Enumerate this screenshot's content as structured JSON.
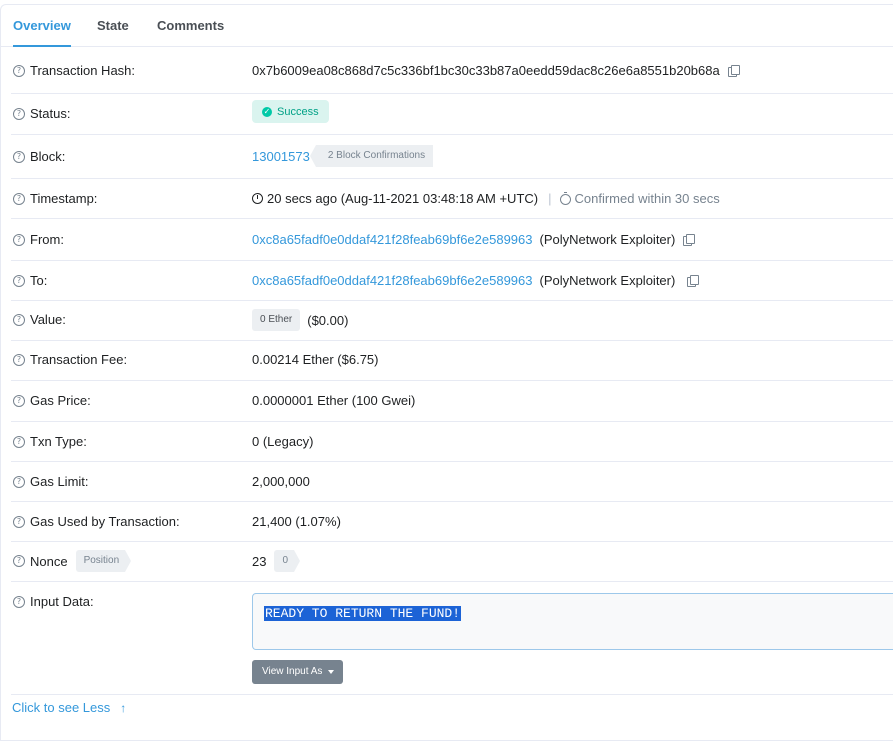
{
  "tabs": [
    "Overview",
    "State",
    "Comments"
  ],
  "labels": {
    "hash": "Transaction Hash:",
    "status": "Status:",
    "block": "Block:",
    "timestamp": "Timestamp:",
    "from": "From:",
    "to": "To:",
    "value": "Value:",
    "fee": "Transaction Fee:",
    "gas_price": "Gas Price:",
    "txn_type": "Txn Type:",
    "gas_limit": "Gas Limit:",
    "gas_used": "Gas Used by Transaction:",
    "nonce": "Nonce",
    "nonce_badge": "Position",
    "input": "Input Data:"
  },
  "values": {
    "hash": "0x7b6009ea08c868d7c5c336bf1bc30c33b87a0eedd59dac8c26e6a8551b20b68a",
    "status": "Success",
    "block_number": "13001573",
    "block_confirmations": "2 Block Confirmations",
    "timestamp": "20 secs ago (Aug-11-2021 03:48:18 AM +UTC)",
    "timestamp_sep": "|",
    "confirmed": "Confirmed within 30 secs",
    "from_address": "0xc8a65fadf0e0ddaf421f28feab69bf6e2e589963",
    "from_name": "(PolyNetwork Exploiter)",
    "to_address": "0xc8a65fadf0e0ddaf421f28feab69bf6e2e589963",
    "to_name": "(PolyNetwork Exploiter)",
    "value_amount": "0 Ether",
    "value_usd": "($0.00)",
    "fee": "0.00214 Ether ($6.75)",
    "gas_price": "0.0000001 Ether (100 Gwei)",
    "txn_type": "0 (Legacy)",
    "gas_limit": "2,000,000",
    "gas_used": "21,400 (1.07%)",
    "nonce": "23",
    "nonce_position": "0",
    "input_data": "READY TO RETURN THE FUND!",
    "view_input_as": "View Input As"
  },
  "footer": {
    "see_less": "Click to see Less"
  },
  "colors": {
    "link": "#3498db",
    "success_bg": "#daf4ef",
    "success_text": "#00a186",
    "button": "#77838f"
  },
  "icons": [
    "question-icon",
    "copy-icon",
    "check-circle-icon",
    "clock-icon",
    "timer-icon",
    "caret-down-icon",
    "arrow-up-icon"
  ]
}
